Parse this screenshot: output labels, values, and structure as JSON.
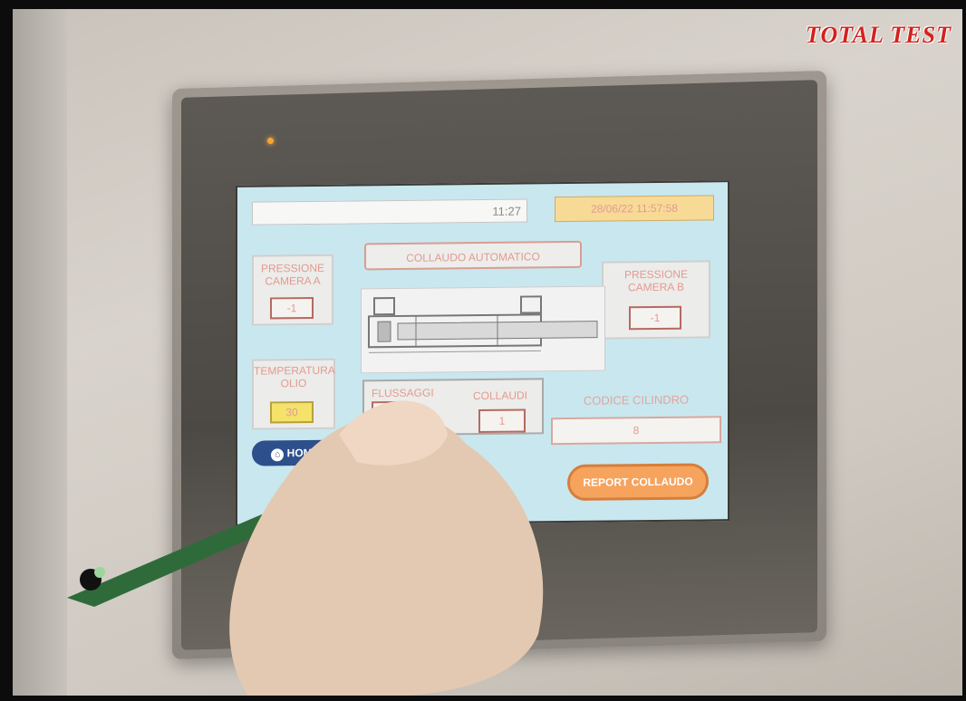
{
  "brand": {
    "logo": "TOTALTEST"
  },
  "hmi": {
    "time": "11:27",
    "datetime": "28/06/22 11:57:58",
    "title": "COLLAUDO AUTOMATICO",
    "pressure_a": {
      "label": "PRESSIONE\nCAMERA A",
      "value": "-1"
    },
    "pressure_b": {
      "label": "PRESSIONE\nCAMERA B",
      "value": "-1"
    },
    "oil_temp": {
      "label": "TEMPERATURA\nOLIO",
      "value": "30"
    },
    "counters": {
      "flussaggi_label": "FLUSSAGGI",
      "collaudi_label": "COLLAUDI",
      "collaudi_value": "1"
    },
    "cylinder_code": {
      "label": "CODICE CILINDRO",
      "value": "8"
    },
    "home_button": {
      "label": "HOME"
    },
    "report_button": {
      "label": "REPORT COLLAUDO"
    }
  },
  "colors": {
    "screen_bg": "#c9e7ef",
    "accent_red": "#d3221e",
    "button_orange": "#f6a35d",
    "oil_value_bg": "#f4e26b"
  }
}
